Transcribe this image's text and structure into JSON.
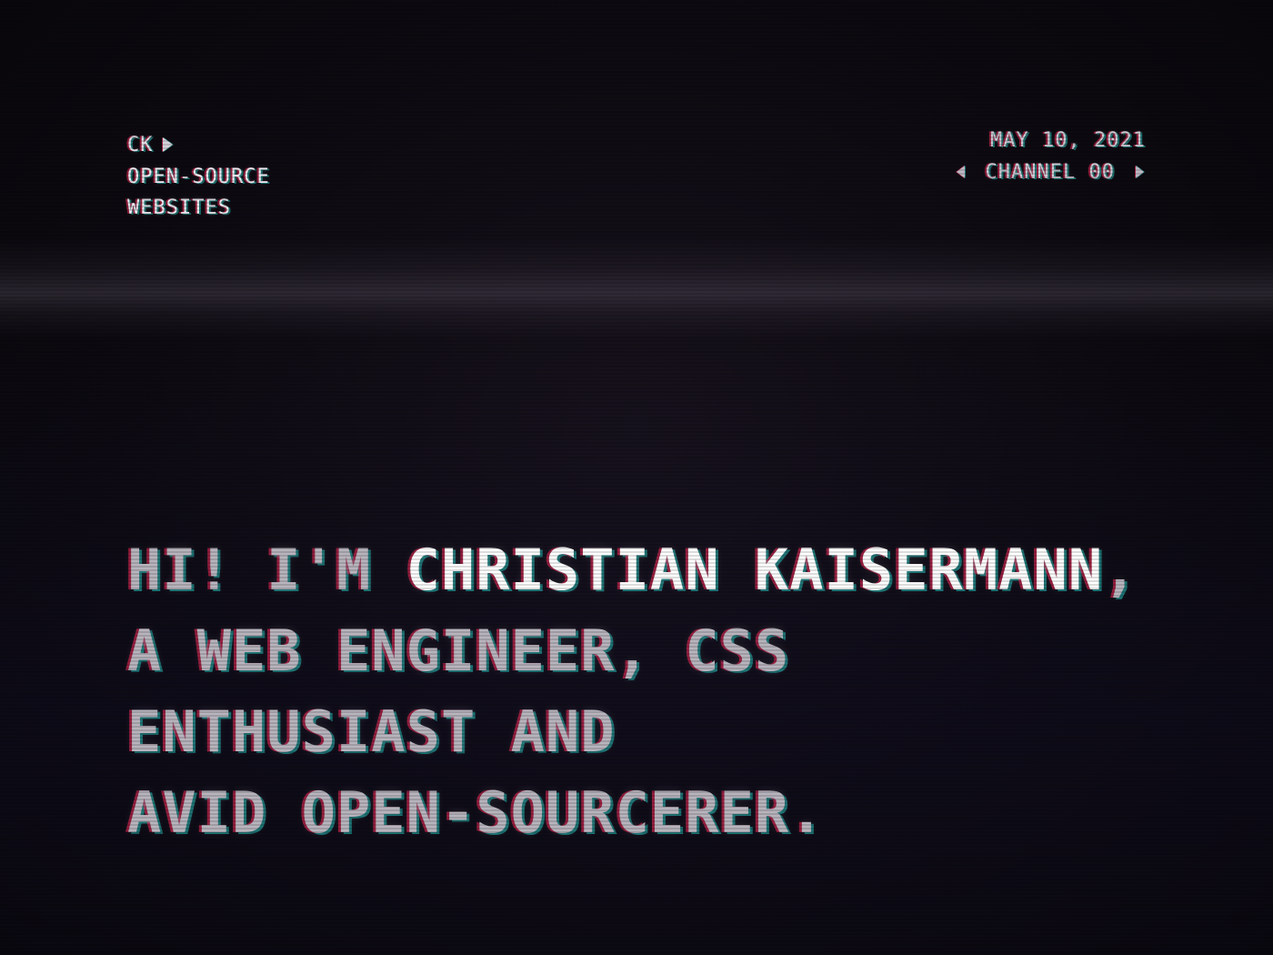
{
  "header": {
    "logo": "CK",
    "menu": [
      {
        "label": "OPEN-SOURCE"
      },
      {
        "label": "WEBSITES"
      }
    ]
  },
  "status": {
    "date": "MAY 10, 2021",
    "channel": "CHANNEL 00"
  },
  "hero": {
    "greeting": "HI! I'M ",
    "name": "CHRISTIAN KAISERMANN",
    "name_suffix": ",",
    "line2": "A WEB ENGINEER, CSS",
    "line3": "ENTHUSIAST AND",
    "line4": "AVID OPEN-SOURCERER."
  },
  "colors": {
    "background": "#0a070d",
    "text": "#e9e6ec",
    "glitch_red": "#ff285a",
    "glitch_cyan": "#28e6dc"
  }
}
